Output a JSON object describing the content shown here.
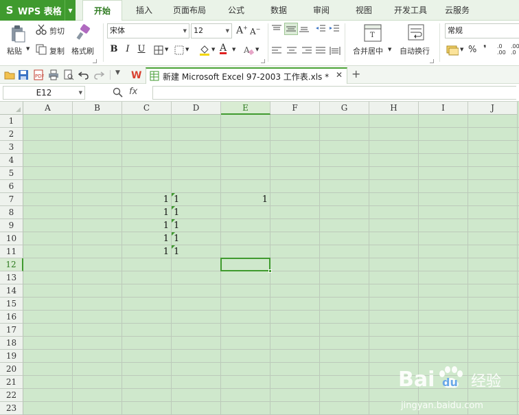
{
  "app": {
    "name": "WPS 表格",
    "logo": "S"
  },
  "tabs": [
    {
      "label": "开始",
      "active": true
    },
    {
      "label": "插入",
      "active": false
    },
    {
      "label": "页面布局",
      "active": false
    },
    {
      "label": "公式",
      "active": false
    },
    {
      "label": "数据",
      "active": false
    },
    {
      "label": "审阅",
      "active": false
    },
    {
      "label": "视图",
      "active": false
    },
    {
      "label": "开发工具",
      "active": false
    },
    {
      "label": "云服务",
      "active": false
    }
  ],
  "ribbon": {
    "paste": "粘贴",
    "cut": "剪切",
    "copy": "复制",
    "format_painter": "格式刷",
    "font_name": "宋体",
    "font_size": "12",
    "merge_center": "合并居中",
    "wrap_text": "自动换行",
    "number_format": "常规",
    "percent": "%",
    "comma": "❜",
    "inc_decimal": ".0\n.00",
    "dec_decimal": ".00\n.0"
  },
  "document": {
    "tab_title": "新建 Microsoft Excel 97-2003 工作表.xls *"
  },
  "formula_bar": {
    "name_box": "E12",
    "fx": "fx",
    "formula": ""
  },
  "sheet": {
    "columns": [
      "A",
      "B",
      "C",
      "D",
      "E",
      "F",
      "G",
      "H",
      "I",
      "J"
    ],
    "rows": [
      "1",
      "2",
      "3",
      "4",
      "5",
      "6",
      "7",
      "8",
      "9",
      "10",
      "11",
      "12",
      "13",
      "14",
      "15",
      "16",
      "17",
      "18",
      "19",
      "20",
      "21",
      "22",
      "23"
    ],
    "selected_cell": "E12",
    "cells": [
      {
        "ref": "C7",
        "value": "1"
      },
      {
        "ref": "D7",
        "value": "1"
      },
      {
        "ref": "C8",
        "value": "1"
      },
      {
        "ref": "D8",
        "value": "1"
      },
      {
        "ref": "C9",
        "value": "1"
      },
      {
        "ref": "D9",
        "value": "1"
      },
      {
        "ref": "C10",
        "value": "1"
      },
      {
        "ref": "D10",
        "value": "1"
      },
      {
        "ref": "C11",
        "value": "1"
      },
      {
        "ref": "D11",
        "value": "1"
      },
      {
        "ref": "E7",
        "value": "1"
      }
    ]
  },
  "watermark": {
    "brand": "Bai",
    "brand2": "du",
    "cn": "经验",
    "url": "jingyan.baidu.com"
  },
  "colors": {
    "accent": "#3f9a2e",
    "grid_bg": "#cfe8cc",
    "header_bg": "#eef2ed"
  }
}
